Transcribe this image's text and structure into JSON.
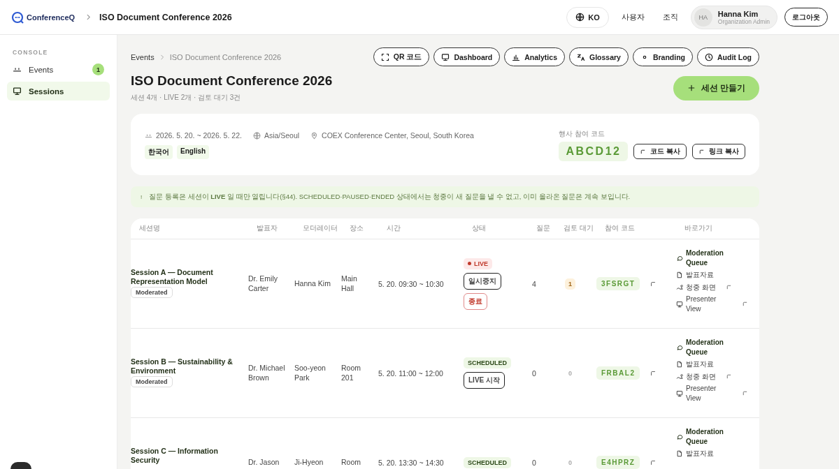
{
  "header": {
    "logo": "ConferenceQ",
    "title": "ISO Document Conference 2026",
    "language": "KO",
    "nav": [
      "사용자",
      "조직"
    ],
    "user": {
      "initials": "HA",
      "name": "Hanna Kim",
      "role": "Organization Admin"
    },
    "logout": "로그아웃"
  },
  "sidebar": {
    "section": "CONSOLE",
    "items": [
      {
        "label": "Events",
        "kind": "events",
        "badge": "1",
        "selected": false
      },
      {
        "label": "Sessions",
        "kind": "sessions",
        "selected": true
      }
    ]
  },
  "breadcrumb": [
    "Events",
    "ISO Document Conference 2026"
  ],
  "toolbar": [
    {
      "label": "QR 코드",
      "kind": "qr"
    },
    {
      "label": "Dashboard",
      "kind": "dashboard"
    },
    {
      "label": "Analytics",
      "kind": "analytics"
    },
    {
      "label": "Glossary",
      "kind": "glossary"
    },
    {
      "label": "Branding",
      "kind": "branding"
    },
    {
      "label": "Audit Log",
      "kind": "audit"
    }
  ],
  "title": "ISO Document Conference 2026",
  "summary": "세션 4개 · LIVE 2개 · 검토 대기 3건",
  "create_button": "세션 만들기",
  "event": {
    "dates": "2026. 5. 20. ~ 2026. 5. 22.",
    "timezone": "Asia/Seoul",
    "venue": "COEX Conference Center, Seoul, South Korea",
    "languages": [
      "한국어",
      "English"
    ],
    "code_label": "행사 참여 코드",
    "code": "ABCD12",
    "copy_buttons": [
      "코드 복사",
      "링크 복사"
    ]
  },
  "notice": {
    "icon": "!",
    "text": "질문 등록은 세션이 **LIVE** 일 때만 열립니다(§44). SCHEDULED·PAUSED·ENDED 상태에서는 청중이 새 질문을 낼 수 없고, 이미 올라온 질문은 계속 보입니다."
  },
  "table": {
    "columns": [
      "세션명",
      "발표자",
      "모더레이터",
      "장소",
      "시간",
      "상태",
      "질문",
      "검토 대기",
      "참여 코드",
      "바로가기"
    ],
    "rows": [
      {
        "title": "Session A — Document Representation Model",
        "mode": "Moderated",
        "speaker": "Dr. Emily Carter",
        "moderator": "Hanna Kim",
        "venue": "Main Hall",
        "time": "5. 20. 09:30 ~ 10:30",
        "status": {
          "label": "LIVE",
          "kind": "live"
        },
        "actions": [
          {
            "label": "일시중지",
            "kind": "outline"
          },
          {
            "label": "종료",
            "kind": "danger"
          }
        ],
        "questions": "4",
        "pending": "1",
        "pending_flagged": true,
        "code": "3FSRGT",
        "shortcuts": [
          {
            "label": "Moderation Queue",
            "kind": "queue"
          },
          {
            "label": "발표자료",
            "kind": "slides"
          },
          {
            "label": "청중 화면",
            "kind": "audience"
          },
          {
            "label": "Presenter View",
            "kind": "presenter"
          }
        ]
      },
      {
        "title": "Session B — Sustainability & Environment",
        "mode": "Moderated",
        "speaker": "Dr. Michael Brown",
        "moderator": "Soo-yeon Park",
        "venue": "Room 201",
        "time": "5. 20. 11:00 ~ 12:00",
        "status": {
          "label": "SCHEDULED",
          "kind": "scheduled"
        },
        "actions": [
          {
            "label": "LIVE 시작",
            "kind": "outline"
          }
        ],
        "questions": "0",
        "pending": "0",
        "pending_flagged": false,
        "code": "FRBAL2",
        "shortcuts": [
          {
            "label": "Moderation Queue",
            "kind": "queue"
          },
          {
            "label": "발표자료",
            "kind": "slides"
          },
          {
            "label": "청중 화면",
            "kind": "audience"
          },
          {
            "label": "Presenter View",
            "kind": "presenter"
          }
        ]
      },
      {
        "title": "Session C — Information Security",
        "speaker": "Dr. Jason",
        "moderator": "Ji-Hyeon",
        "venue": "Room",
        "time": "5. 20. 13:30 ~ 14:30",
        "status": {
          "label": "SCHEDULED",
          "kind": "scheduled"
        },
        "actions": [],
        "questions": "0",
        "pending": "0",
        "pending_flagged": false,
        "code": "E4HPRZ",
        "shortcuts": [
          {
            "label": "Moderation Queue",
            "kind": "queue"
          },
          {
            "label": "발표자료",
            "kind": "slides"
          }
        ]
      }
    ]
  }
}
